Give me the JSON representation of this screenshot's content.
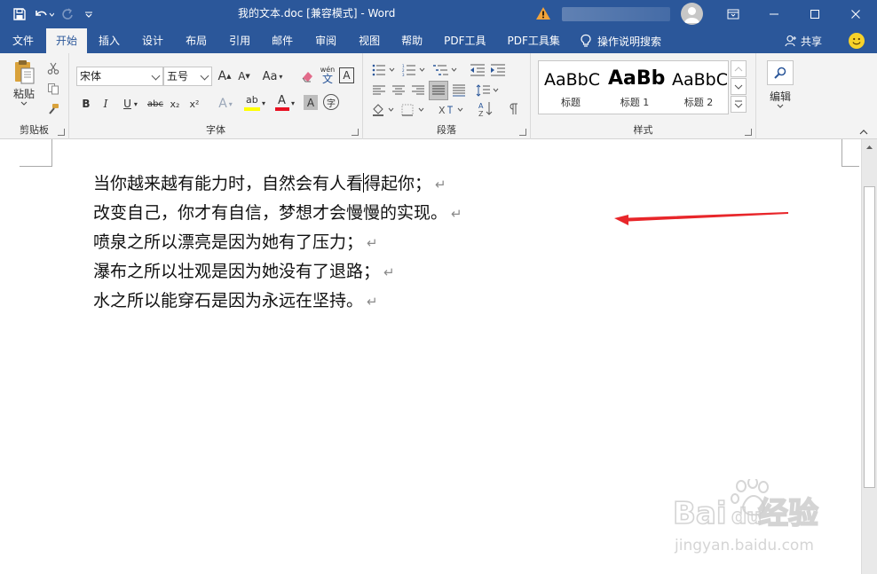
{
  "window": {
    "title": "我的文本.doc [兼容模式] - Word"
  },
  "tabs": [
    "文件",
    "开始",
    "插入",
    "设计",
    "布局",
    "引用",
    "邮件",
    "审阅",
    "视图",
    "帮助",
    "PDF工具",
    "PDF工具集"
  ],
  "active_tab": "开始",
  "tell_me": "操作说明搜索",
  "share": "共享",
  "ribbon": {
    "clipboard": {
      "paste_label": "粘贴",
      "group_label": "剪贴板"
    },
    "font": {
      "font_name": "宋体",
      "font_size": "五号",
      "group_label": "字体",
      "aa_label": "Aa",
      "wen_label": "wén",
      "wen_char": "文",
      "a_boxed": "A",
      "bold": "B",
      "italic": "I",
      "underline": "U",
      "strike": "abc",
      "sub": "x₂",
      "sup": "x²",
      "font_color_letter": "A",
      "char_shade": "A",
      "enclosed_char": "字",
      "grow": "A",
      "shrink": "A",
      "text_effect": "A",
      "highlight": "ab"
    },
    "paragraph": {
      "group_label": "段落"
    },
    "styles": {
      "group_label": "样式",
      "items": [
        {
          "sample": "AaBbC",
          "name": "标题"
        },
        {
          "sample": "AaBb",
          "name": "标题 1"
        },
        {
          "sample": "AaBbC",
          "name": "标题 2"
        }
      ]
    },
    "editing": {
      "label": "编辑"
    }
  },
  "colors": {
    "brand": "#2b579a",
    "highlight": "#ffff00",
    "font_color": "#e81123",
    "annotation_arrow": "#e8262a"
  },
  "document": {
    "lines": [
      {
        "before": "当你越来越有能力时，自然会有人看",
        "after": "得起你；"
      },
      {
        "before": "改变自己，你才有自信，梦想才会慢慢的实现。",
        "after": ""
      },
      {
        "before": "喷泉之所以漂亮是因为她有了压力；",
        "after": ""
      },
      {
        "before": "瀑布之所以壮观是因为她没有了退路；",
        "after": ""
      },
      {
        "before": "水之所以能穿石是因为永远在坚持。",
        "after": ""
      }
    ],
    "para_mark": "↵"
  },
  "watermark": {
    "brand": "Bai du 经验",
    "url": "jingyan.baidu.com"
  }
}
